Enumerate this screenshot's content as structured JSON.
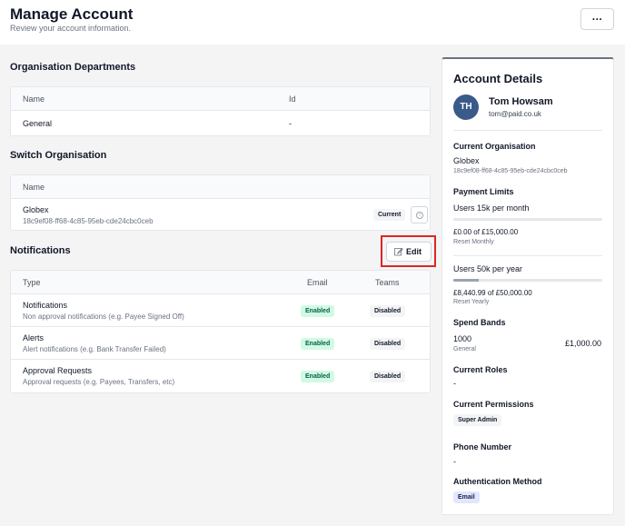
{
  "header": {
    "title": "Manage Account",
    "subtitle": "Review your account information.",
    "more_label": "..."
  },
  "departments": {
    "title": "Organisation Departments",
    "columns": [
      "Name",
      "Id"
    ],
    "rows": [
      {
        "name": "General",
        "id": "-"
      }
    ]
  },
  "switch_org": {
    "title": "Switch Organisation",
    "column": "Name",
    "rows": [
      {
        "name": "Globex",
        "id": "18c9ef08-ff68-4c85-95eb-cde24cbc0ceb",
        "badge": "Current"
      }
    ]
  },
  "notifications": {
    "title": "Notifications",
    "edit_label": "Edit",
    "columns": [
      "Type",
      "Email",
      "Teams"
    ],
    "rows": [
      {
        "name": "Notifications",
        "desc": "Non approval notifications (e.g. Payee Signed Off)",
        "email": "Enabled",
        "teams": "Disabled"
      },
      {
        "name": "Alerts",
        "desc": "Alert notifications (e.g. Bank Transfer Failed)",
        "email": "Enabled",
        "teams": "Disabled"
      },
      {
        "name": "Approval Requests",
        "desc": "Approval requests (e.g. Payees, Transfers, etc)",
        "email": "Enabled",
        "teams": "Disabled"
      }
    ]
  },
  "account": {
    "title": "Account Details",
    "initials": "TH",
    "name": "Tom Howsam",
    "email": "tom@paid.co.uk",
    "current_org_label": "Current Organisation",
    "current_org_name": "Globex",
    "current_org_id": "18c9ef08-ff68-4c85-95eb-cde24cbc0ceb",
    "payment_limits_label": "Payment Limits",
    "limits": [
      {
        "name": "Users 15k per month",
        "amount": "£0.00 of £15,000.00",
        "reset": "Reset Monthly",
        "fraction": 0.0
      },
      {
        "name": "Users 50k per year",
        "amount": "£8,440.99 of £50,000.00",
        "reset": "Reset Yearly",
        "fraction": 0.17
      }
    ],
    "spend_bands_label": "Spend Bands",
    "spend_band": {
      "name": "1000",
      "group": "General",
      "amount": "£1,000.00"
    },
    "roles_label": "Current Roles",
    "roles_value": "-",
    "permissions_label": "Current Permissions",
    "permission": "Super Admin",
    "phone_label": "Phone Number",
    "phone_value": "-",
    "auth_label": "Authentication Method",
    "auth_value": "Email"
  },
  "colors": {
    "accent": "#3a5a8a",
    "enabled_bg": "#d1fae5",
    "enabled_text": "#065f46",
    "highlight": "#dc2626",
    "auth_chip": "#e0e7ff"
  }
}
